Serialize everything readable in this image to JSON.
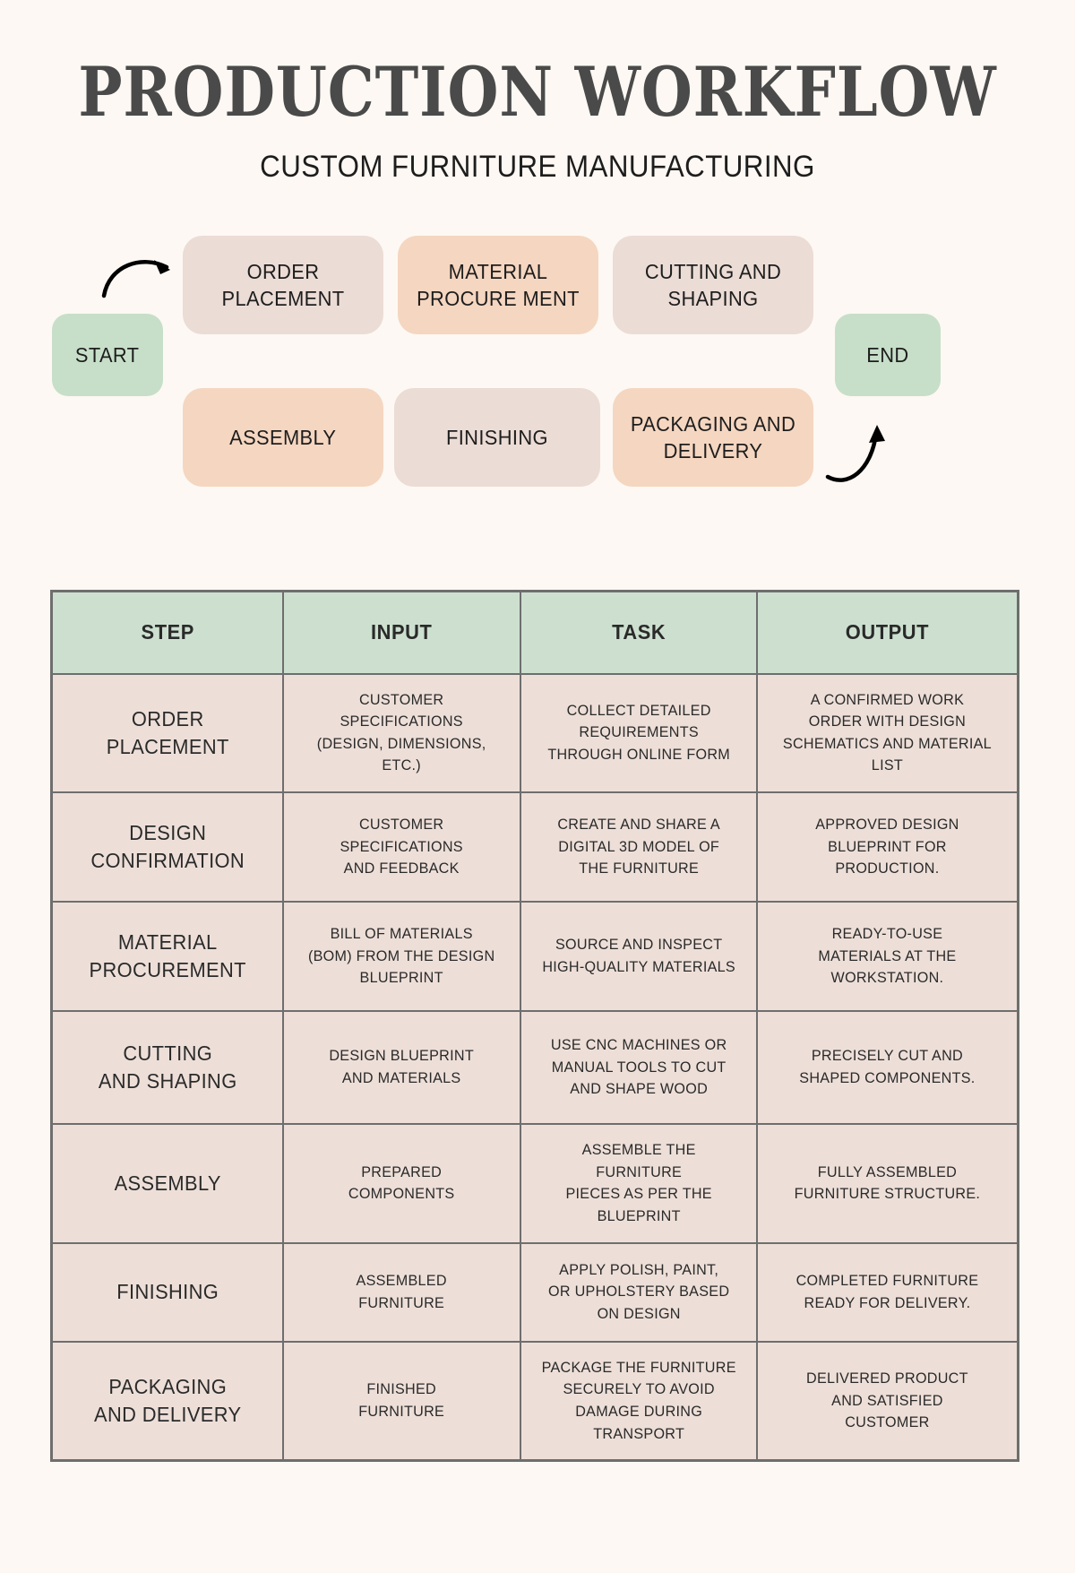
{
  "header": {
    "title": "PRODUCTION WORKFLOW",
    "subtitle": "CUSTOM FURNITURE MANUFACTURING"
  },
  "colors": {
    "background": "#fdf8f3",
    "pink_node": "#ebdcd5",
    "peach_node": "#f5d6c0",
    "green_node": "#c7dfc9",
    "table_header": "#cde0d0",
    "table_cell": "#eddfd8",
    "border": "#6e6e6e",
    "title_text": "#4a4a4a"
  },
  "flow": {
    "start_label": "START",
    "end_label": "END",
    "nodes": [
      {
        "label": "ORDER\nPLACEMENT",
        "color": "pink"
      },
      {
        "label": "MATERIAL\nPROCURE MENT",
        "color": "peach"
      },
      {
        "label": "CUTTING\nAND SHAPING",
        "color": "pink"
      },
      {
        "label": "ASSEMBLY",
        "color": "peach"
      },
      {
        "label": "FINISHING",
        "color": "pink"
      },
      {
        "label": "PACKAGING\nAND\nDELIVERY",
        "color": "peach"
      }
    ],
    "arrows": [
      {
        "name": "start-to-order-arrow"
      },
      {
        "name": "packaging-to-end-arrow"
      }
    ]
  },
  "table": {
    "headers": [
      "STEP",
      "INPUT",
      "TASK",
      "OUTPUT"
    ],
    "rows": [
      {
        "step": "ORDER\nPLACEMENT",
        "input": "CUSTOMER\nSPECIFICATIONS\n(DESIGN, DIMENSIONS,\nETC.)",
        "task": "COLLECT DETAILED\nREQUIREMENTS\nTHROUGH ONLINE FORM",
        "output": "A CONFIRMED WORK\nORDER WITH DESIGN\nSCHEMATICS AND MATERIAL\nLIST"
      },
      {
        "step": "DESIGN\nCONFIRMATION",
        "input": "CUSTOMER\nSPECIFICATIONS\nAND FEEDBACK",
        "task": "CREATE AND SHARE A\nDIGITAL 3D MODEL OF\nTHE FURNITURE",
        "output": "APPROVED DESIGN\nBLUEPRINT FOR\nPRODUCTION."
      },
      {
        "step": "MATERIAL\nPROCUREMENT",
        "input": "BILL OF MATERIALS\n(BOM) FROM THE DESIGN\nBLUEPRINT",
        "task": "SOURCE AND INSPECT\nHIGH-QUALITY MATERIALS",
        "output": "READY-TO-USE\nMATERIALS AT THE\nWORKSTATION."
      },
      {
        "step": "CUTTING\nAND SHAPING",
        "input": "DESIGN BLUEPRINT\nAND MATERIALS",
        "task": "USE CNC MACHINES OR\nMANUAL TOOLS TO CUT\nAND SHAPE WOOD",
        "output": "PRECISELY CUT AND\nSHAPED COMPONENTS."
      },
      {
        "step": "ASSEMBLY",
        "input": "PREPARED\nCOMPONENTS",
        "task": "ASSEMBLE THE FURNITURE\nPIECES AS PER THE\nBLUEPRINT",
        "output": "FULLY ASSEMBLED\nFURNITURE STRUCTURE."
      },
      {
        "step": "FINISHING",
        "input": "ASSEMBLED\nFURNITURE",
        "task": "APPLY POLISH, PAINT,\nOR UPHOLSTERY BASED\nON DESIGN",
        "output": "COMPLETED FURNITURE\nREADY FOR DELIVERY."
      },
      {
        "step": "PACKAGING\nAND DELIVERY",
        "input": "FINISHED\nFURNITURE",
        "task": "PACKAGE THE FURNITURE\nSECURELY TO AVOID\nDAMAGE DURING\nTRANSPORT",
        "output": "DELIVERED PRODUCT\nAND SATISFIED\nCUSTOMER"
      }
    ]
  }
}
